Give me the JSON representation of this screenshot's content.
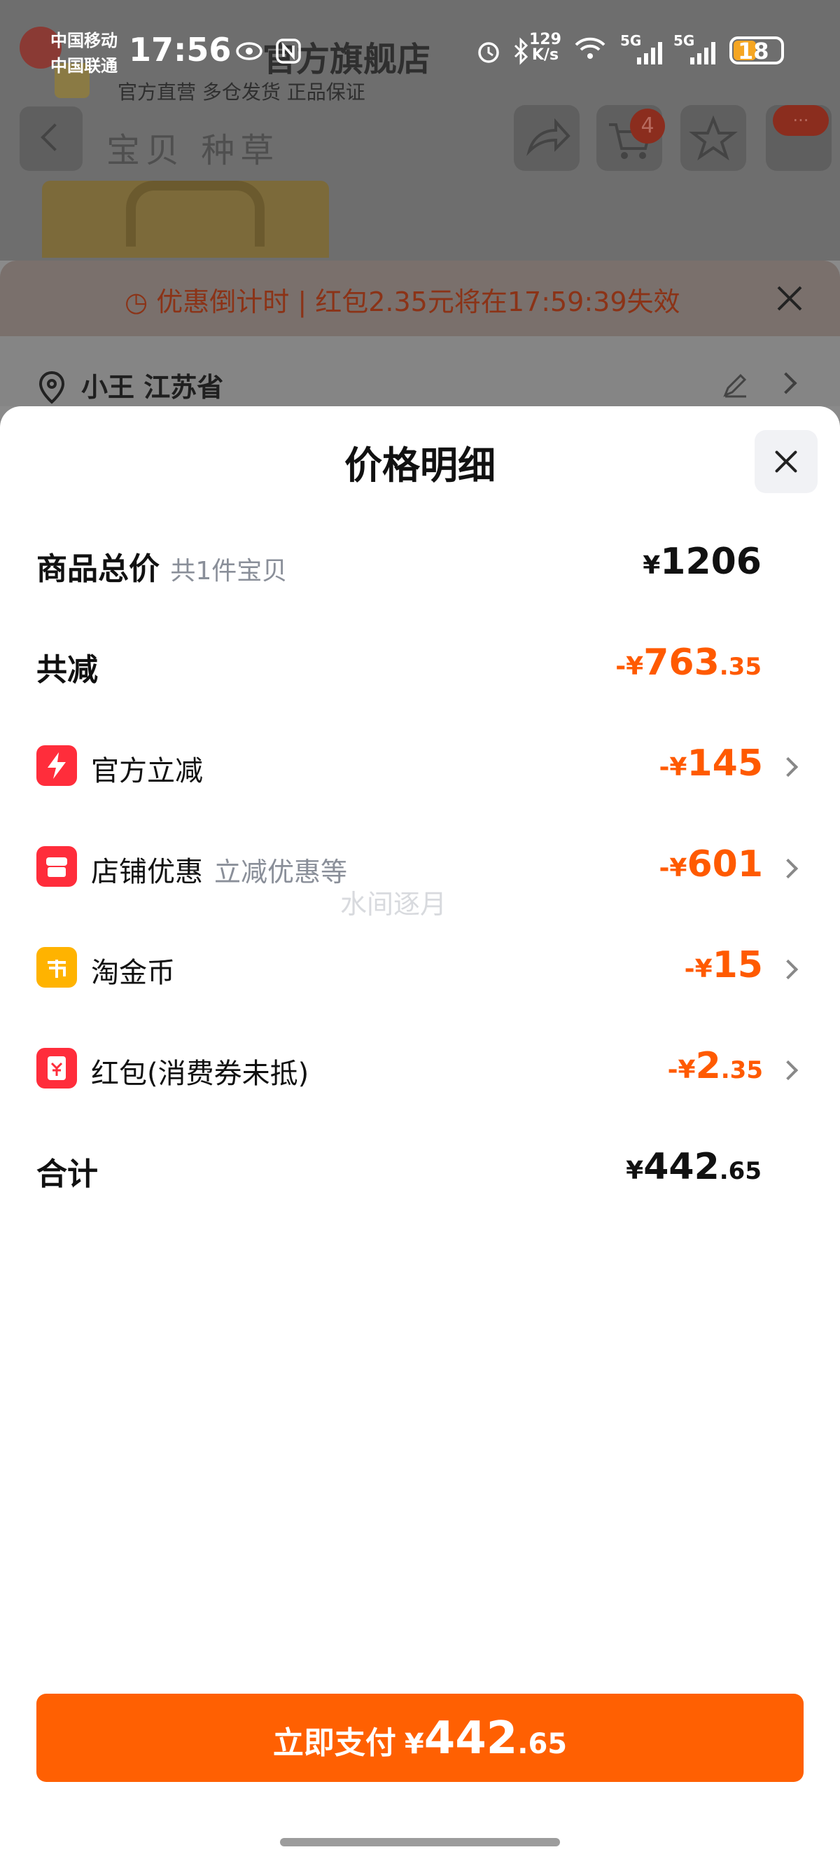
{
  "status_bar": {
    "carrier1": "中国移动",
    "carrier2": "中国联通",
    "time": "17:56",
    "net_speed_value": "129",
    "net_speed_unit": "K/s",
    "battery": "18",
    "network_labels": [
      "5G",
      "5G"
    ]
  },
  "background": {
    "store_name": "官方旗舰店",
    "store_sub": "官方直营  多仓发货  正品保证",
    "tabs": "宝贝  种草",
    "cart_badge": "4",
    "more_badge": "···",
    "countdown": "优惠倒计时 | 红包2.35元将在17:59:39失效",
    "address": "小王 江苏省"
  },
  "sheet": {
    "title": "价格明细",
    "total": {
      "label": "商品总价",
      "sub": "共1件宝贝",
      "currency": "¥",
      "amount": "1206"
    },
    "discount": {
      "label": "共减",
      "prefix": "-¥",
      "int": "763",
      "dec": ".35"
    },
    "items": [
      {
        "label": "官方立减",
        "sub": "",
        "prefix": "-¥",
        "int": "145",
        "dec": "",
        "icon": "lightning-icon",
        "color": "#ff2d3b"
      },
      {
        "label": "店铺优惠",
        "sub": "立减优惠等",
        "prefix": "-¥",
        "int": "601",
        "dec": "",
        "icon": "shop-icon",
        "color": "#ff2d3b"
      },
      {
        "label": "淘金币",
        "sub": "",
        "prefix": "-¥",
        "int": "15",
        "dec": "",
        "icon": "coin-icon",
        "color": "#ffb300"
      },
      {
        "label": "红包(消费券未抵)",
        "sub": "",
        "prefix": "-¥",
        "int": "2",
        "dec": ".35",
        "icon": "red-packet-icon",
        "color": "#ff2d3b"
      }
    ],
    "sum": {
      "label": "合计",
      "currency": "¥",
      "int": "442",
      "dec": ".65"
    },
    "watermark": "水间逐月",
    "pay_button": {
      "label": "立即支付",
      "currency": "¥",
      "int": "442",
      "dec": ".65"
    }
  },
  "colors": {
    "accent": "#ff6002",
    "discount": "#ff5a00"
  }
}
